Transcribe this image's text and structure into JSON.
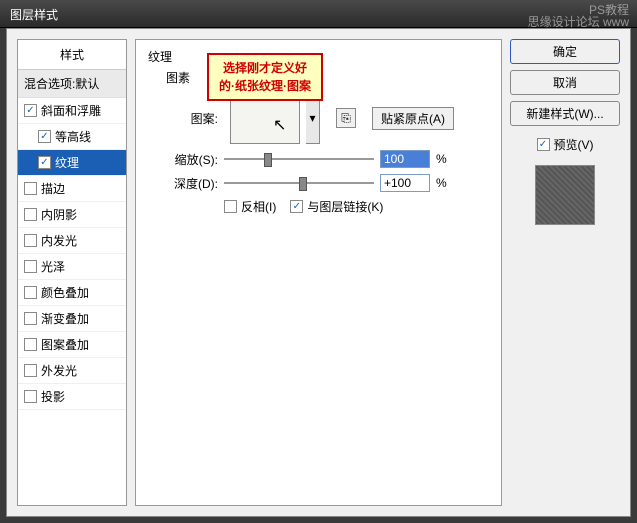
{
  "window": {
    "title": "图层样式"
  },
  "watermark": {
    "line1": "思缘设计论坛 www",
    "line2": "PS教程"
  },
  "annotation": {
    "line1": "选择刚才定义好",
    "line2": "的·纸张纹理·图案"
  },
  "styles_panel": {
    "header": "样式",
    "blend": "混合选项:默认",
    "items": [
      {
        "label": "斜面和浮雕",
        "checked": true,
        "child": false,
        "selected": false
      },
      {
        "label": "等高线",
        "checked": true,
        "child": true,
        "selected": false
      },
      {
        "label": "纹理",
        "checked": true,
        "child": true,
        "selected": true
      },
      {
        "label": "描边",
        "checked": false,
        "child": false,
        "selected": false
      },
      {
        "label": "内阴影",
        "checked": false,
        "child": false,
        "selected": false
      },
      {
        "label": "内发光",
        "checked": false,
        "child": false,
        "selected": false
      },
      {
        "label": "光泽",
        "checked": false,
        "child": false,
        "selected": false
      },
      {
        "label": "颜色叠加",
        "checked": false,
        "child": false,
        "selected": false
      },
      {
        "label": "渐变叠加",
        "checked": false,
        "child": false,
        "selected": false
      },
      {
        "label": "图案叠加",
        "checked": false,
        "child": false,
        "selected": false
      },
      {
        "label": "外发光",
        "checked": false,
        "child": false,
        "selected": false
      },
      {
        "label": "投影",
        "checked": false,
        "child": false,
        "selected": false
      }
    ]
  },
  "texture_panel": {
    "group": "纹理",
    "elements_label": "图素",
    "pattern_label": "图案:",
    "snap_btn": "贴紧原点(A)",
    "scale_label": "缩放(S):",
    "scale_value": "100",
    "scale_unit": "%",
    "depth_label": "深度(D):",
    "depth_value": "+100",
    "depth_unit": "%",
    "invert_label": "反相(I)",
    "link_label": "与图层链接(K)",
    "icon_new": "⎘"
  },
  "buttons": {
    "ok": "确定",
    "cancel": "取消",
    "new_style": "新建样式(W)...",
    "preview": "预览(V)"
  }
}
